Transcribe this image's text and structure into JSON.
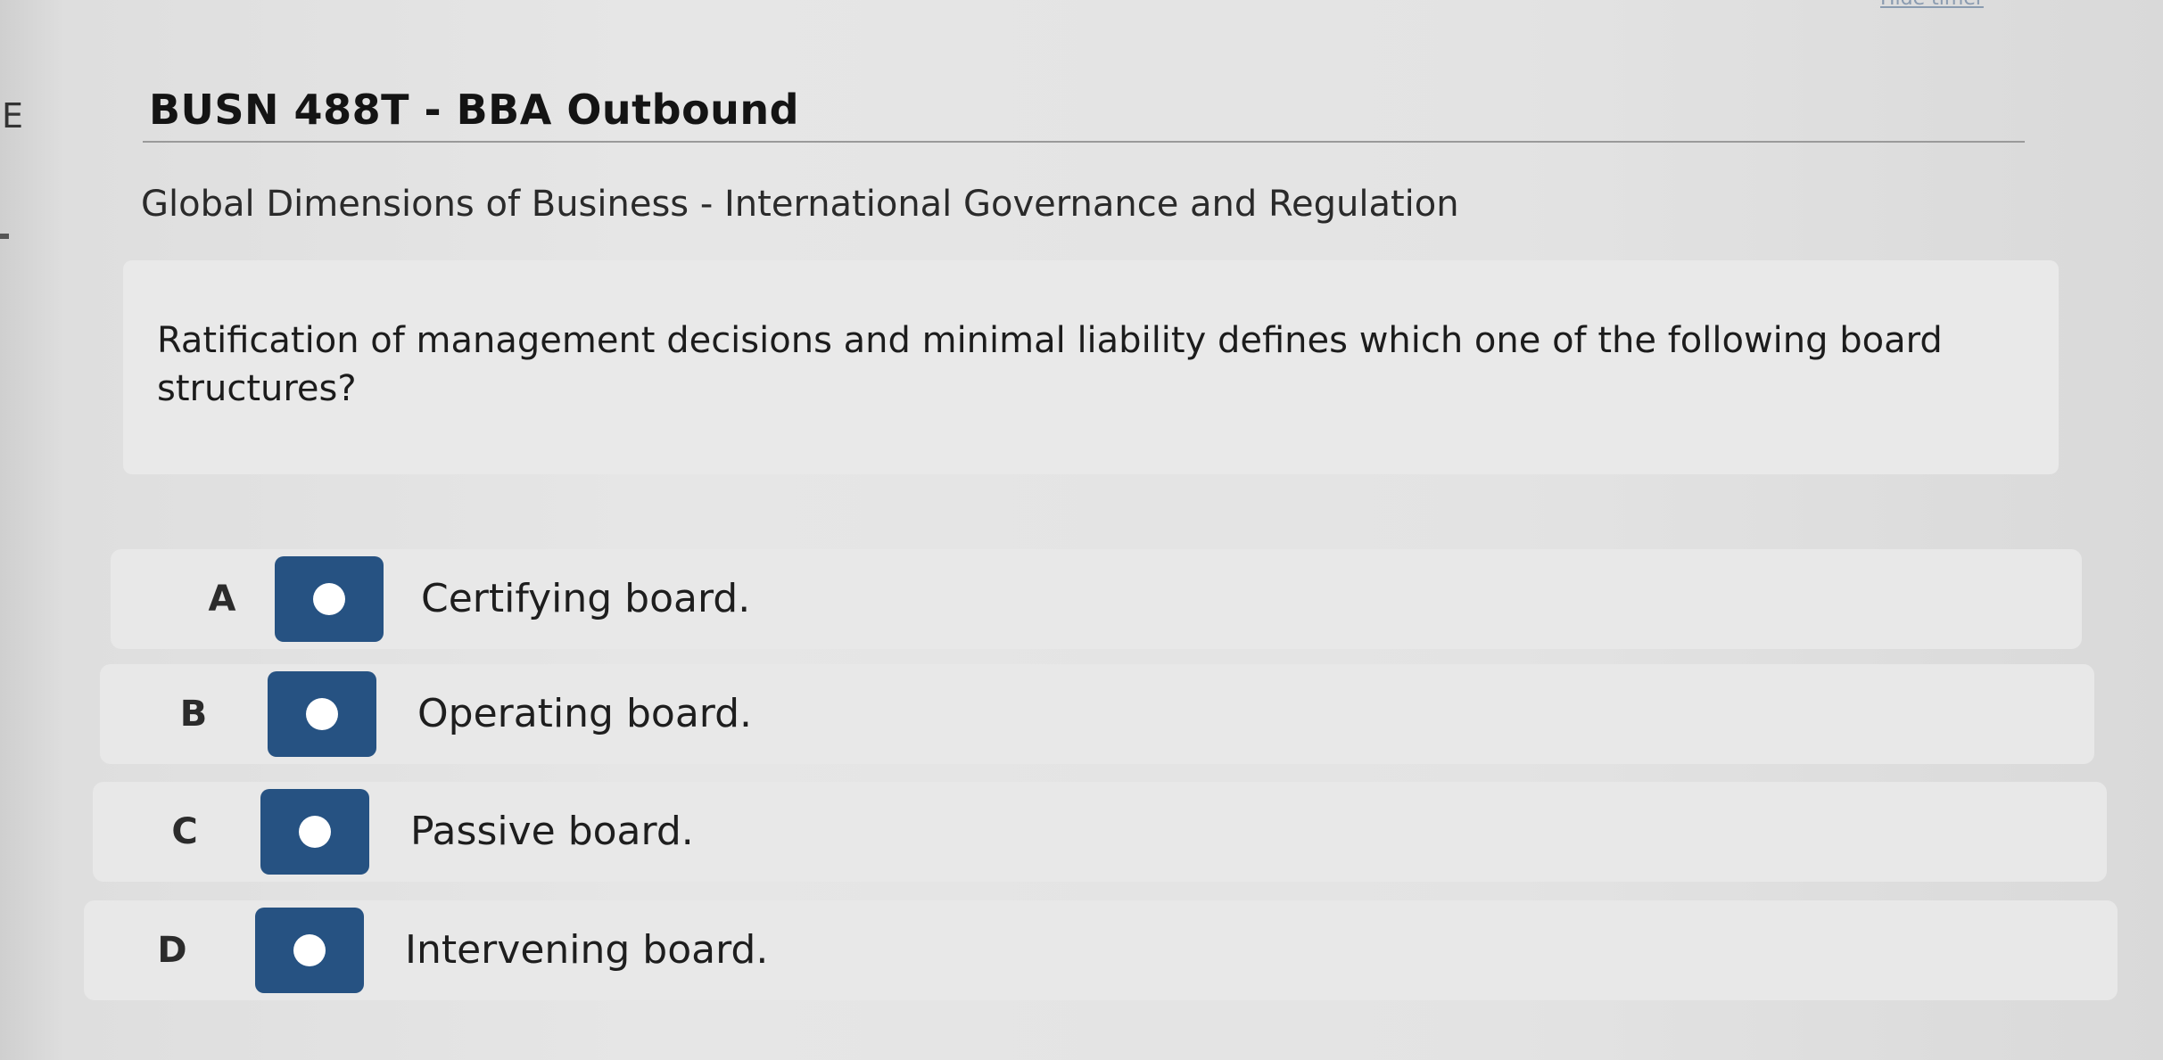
{
  "header": {
    "timer_link": "Hide timer",
    "course_title": "BUSN 488T - BBA Outbound",
    "edge_glyph": "E"
  },
  "topic": "Global Dimensions of Business - International Governance and Regulation",
  "question": {
    "text": "Ratification of management decisions and minimal liability defines which one of the following board structures?"
  },
  "options": [
    {
      "letter": "A",
      "text": "Certifying board.",
      "selected": false
    },
    {
      "letter": "B",
      "text": "Operating board.",
      "selected": false
    },
    {
      "letter": "C",
      "text": "Passive board.",
      "selected": false
    },
    {
      "letter": "D",
      "text": "Intervening board.",
      "selected": false
    }
  ],
  "colors": {
    "radio_box": "#265282",
    "radio_dot": "#ffffff",
    "row_background": "#e8e8e8"
  }
}
